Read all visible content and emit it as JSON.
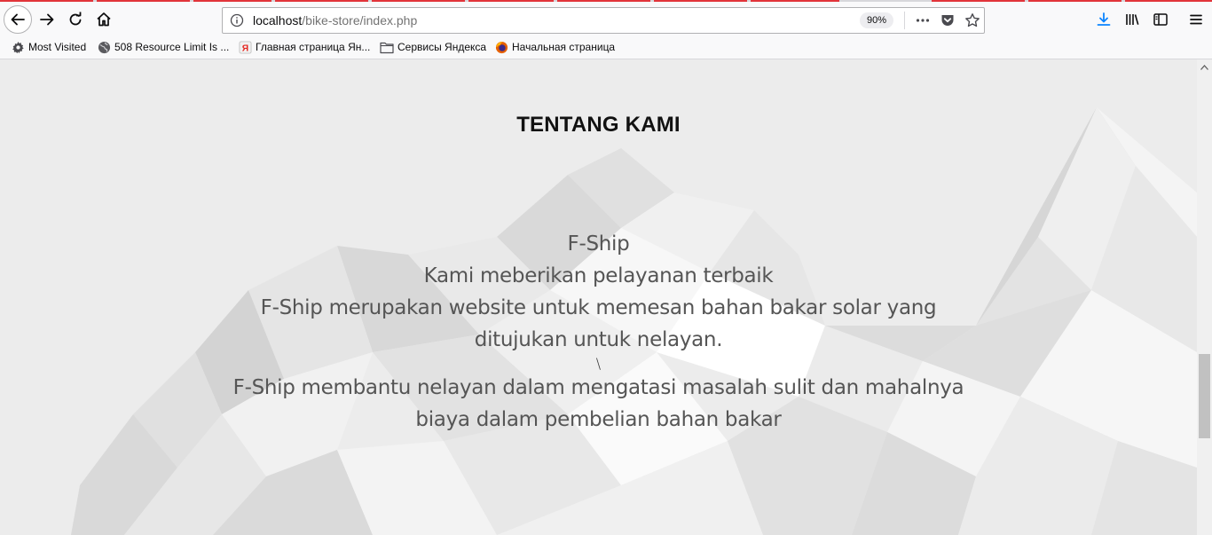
{
  "browser": {
    "url": {
      "host": "localhost",
      "path": "/bike-store/index.php"
    },
    "zoom": "90%",
    "icons": {
      "back": "back-arrow-icon",
      "forward": "forward-arrow-icon",
      "reload": "reload-icon",
      "home": "home-icon",
      "info": "info-icon",
      "more": "more-dots-icon",
      "pocket": "pocket-icon",
      "bookmark": "star-icon",
      "download": "download-icon",
      "library": "library-icon",
      "sidebar": "sidebar-icon",
      "menu": "hamburger-menu-icon"
    },
    "bookmarks": [
      {
        "label": "Most Visited",
        "icon": "gear-icon"
      },
      {
        "label": "508 Resource Limit Is ...",
        "icon": "globe-icon"
      },
      {
        "label": "Главная страница Ян...",
        "icon": "yandex-icon"
      },
      {
        "label": "Сервисы Яндекса",
        "icon": "folder-icon"
      },
      {
        "label": "Начальная страница",
        "icon": "firefox-icon"
      }
    ],
    "accent_color": "#e2343a"
  },
  "page": {
    "heading": "TENTANG KAMI",
    "about": {
      "line1": "F-Ship",
      "line2": "Kami meberikan pelayanan terbaik",
      "line3": "F-Ship merupakan website untuk memesan bahan bakar solar yang",
      "line4": "ditujukan untuk nelayan.",
      "separator": "\\",
      "line5": "F-Ship membantu nelayan dalam mengatasi masalah sulit dan mahalnya",
      "line6": "biaya dalam pembelian bahan bakar"
    },
    "background_color": "#ececec"
  }
}
